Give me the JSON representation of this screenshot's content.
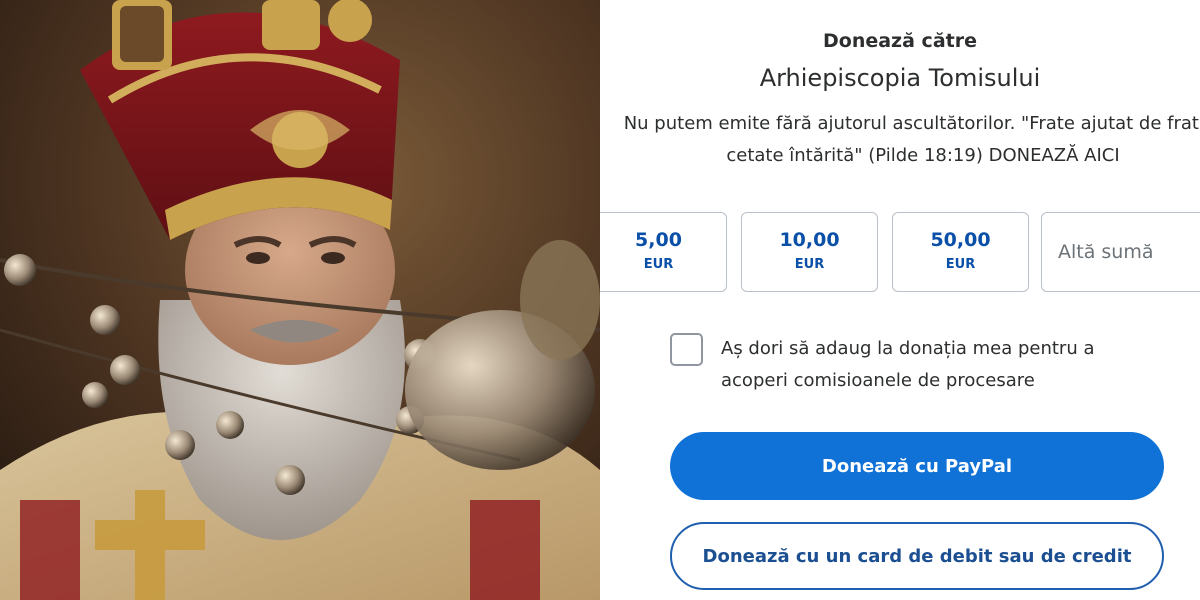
{
  "donation": {
    "heading": "Donează către",
    "organization": "Arhiepiscopia Tomisului",
    "description": "Nu putem emite fără ajutorul ascultătorilor. \"Frate ajutat de frate - cetate întărită\" (Pilde 18:19) DONEAZĂ AICI",
    "amounts": [
      {
        "value": "5,00",
        "currency": "EUR"
      },
      {
        "value": "10,00",
        "currency": "EUR"
      },
      {
        "value": "50,00",
        "currency": "EUR"
      }
    ],
    "other_amount_placeholder": "Altă sumă",
    "cover_fees_label": "Aș dori să adaug la donația mea pentru a acoperi comisioanele de procesare",
    "paypal_button": "Donează cu PayPal",
    "card_button": "Donează cu un card de debit sau de credit"
  },
  "colors": {
    "primary_blue": "#1072d6",
    "text_dark": "#2c2e2f",
    "amount_blue": "#0a4fa8"
  }
}
